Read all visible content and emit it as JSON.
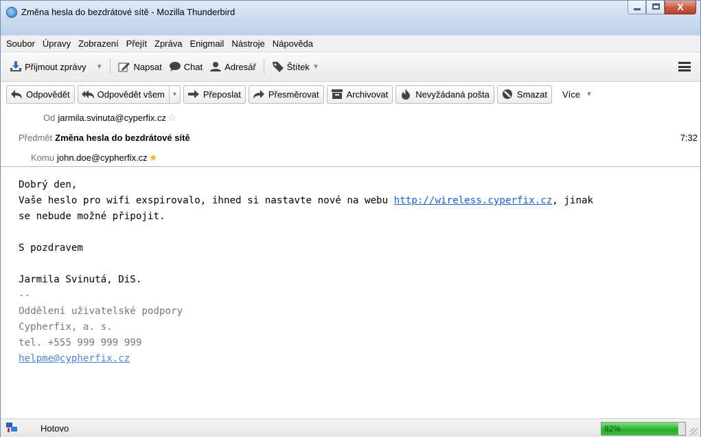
{
  "window": {
    "title": "Změna hesla do bezdrátové sítě - Mozilla Thunderbird",
    "close_glyph": "X"
  },
  "menu": [
    "Soubor",
    "Úpravy",
    "Zobrazení",
    "Přejít",
    "Zpráva",
    "Enigmail",
    "Nástroje",
    "Nápověda"
  ],
  "toolbar": {
    "get_mail": "Přijmout zprávy",
    "write": "Napsat",
    "chat": "Chat",
    "address_book": "Adresář",
    "tag": "Štítek"
  },
  "actions": {
    "reply": "Odpovědět",
    "reply_all": "Odpovědět všem",
    "forward": "Přeposlat",
    "redirect": "Přesměrovat",
    "archive": "Archivovat",
    "junk": "Nevyžádaná pošta",
    "delete": "Smazat",
    "more": "Více"
  },
  "header": {
    "from_label": "Od",
    "from_value": "jarmila.svinuta@cyperfix.cz",
    "subject_label": "Předmět",
    "subject_value": "Změna hesla do bezdrátové sítě",
    "time": "7:32",
    "to_label": "Komu",
    "to_value": "john.doe@cypherfix.cz"
  },
  "body": {
    "greeting": "Dobrý den,",
    "line1_pre": "Vaše heslo pro wifi exspirovalo, ihned si nastavte nové na webu ",
    "link": "http://wireless.cyperfix.cz",
    "line1_post": ", jinak",
    "line2": "se nebude možné připojit.",
    "closing": "S pozdravem",
    "name": "Jarmila Svinutá, DiS.",
    "sig_sep": "--",
    "sig_dept": "Oddělení uživatelské podpory",
    "sig_company": "Cypherfix, a. s.",
    "sig_phone": "tel. +555 999 999 999",
    "sig_email": "helpme@cypherfix.cz"
  },
  "status": {
    "text": "Hotovo",
    "progress_label": "92%",
    "progress_value": 92
  },
  "icons": {
    "app": "thunderbird-icon",
    "star_from": "star-outline-icon",
    "star_to": "star-filled-icon"
  }
}
